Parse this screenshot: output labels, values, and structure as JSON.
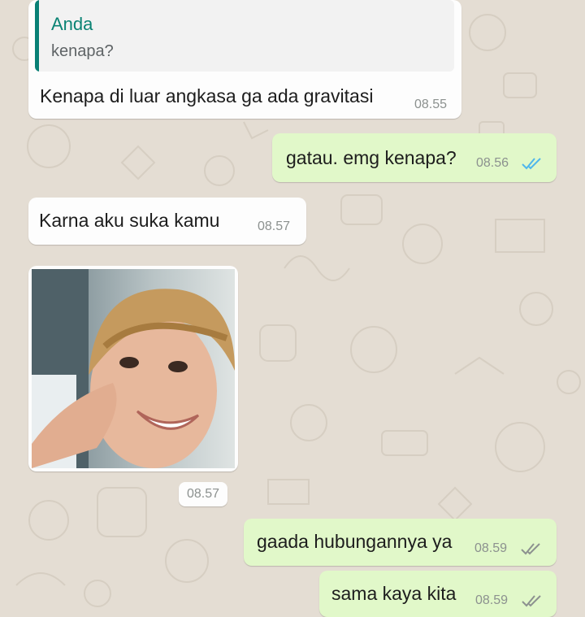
{
  "colors": {
    "wallpaper": "#e4ddd3",
    "incoming_bubble": "#fdfdfd",
    "outgoing_bubble": "#e1f8c9",
    "quote_accent": "#087f74",
    "read_ticks": "#4fb6ec",
    "delivered_ticks": "#8c918f"
  },
  "messages": [
    {
      "direction": "incoming",
      "quoted": {
        "author": "Anda",
        "text": "kenapa?"
      },
      "text": "Kenapa di luar angkasa ga ada gravitasi",
      "time": "08.55"
    },
    {
      "direction": "outgoing",
      "text": "gatau. emg kenapa?",
      "time": "08.56",
      "status": "read",
      "status_icon": "double-check-icon"
    },
    {
      "direction": "incoming",
      "text": "Karna aku suka kamu",
      "time": "08.57"
    },
    {
      "direction": "incoming",
      "type": "image",
      "time": "08.57"
    },
    {
      "direction": "outgoing",
      "text": "gaada hubungannya ya",
      "time": "08.59",
      "status": "delivered",
      "status_icon": "double-check-icon"
    },
    {
      "direction": "outgoing",
      "text": "sama kaya kita",
      "time": "08.59",
      "status": "delivered",
      "status_icon": "double-check-icon"
    }
  ]
}
